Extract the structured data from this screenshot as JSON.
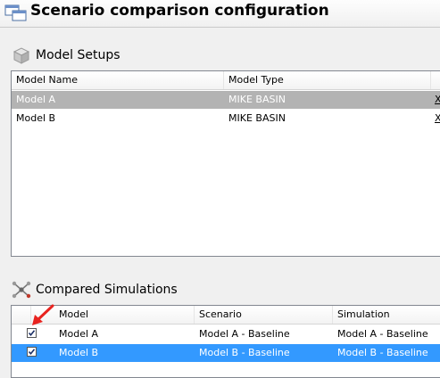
{
  "page": {
    "title": "Scenario comparison configuration",
    "title_icon": "windows-stack-icon"
  },
  "model_setups": {
    "label": "Model Setups",
    "icon": "cube-icon",
    "columns": [
      "Model Name",
      "Model Type"
    ],
    "rows": [
      {
        "name": "Model A",
        "type": "MIKE BASIN",
        "action": "X",
        "selected": true
      },
      {
        "name": "Model B",
        "type": "MIKE BASIN",
        "action": "X",
        "selected": false
      }
    ]
  },
  "compared_simulations": {
    "label": "Compared Simulations",
    "icon": "network-icon",
    "columns": [
      "Model",
      "Scenario",
      "Simulation"
    ],
    "rows": [
      {
        "checked": true,
        "model": "Model A",
        "scenario": "Model A - Baseline",
        "simulation": "Model A - Baseline",
        "selected": false
      },
      {
        "checked": true,
        "model": "Model B",
        "scenario": "Model B - Baseline",
        "simulation": "Model B - Baseline",
        "selected": true
      }
    ]
  },
  "colors": {
    "selection_blue": "#3399ff",
    "selection_gray": "#b3b3b3",
    "annotation_arrow": "#e8231f"
  }
}
